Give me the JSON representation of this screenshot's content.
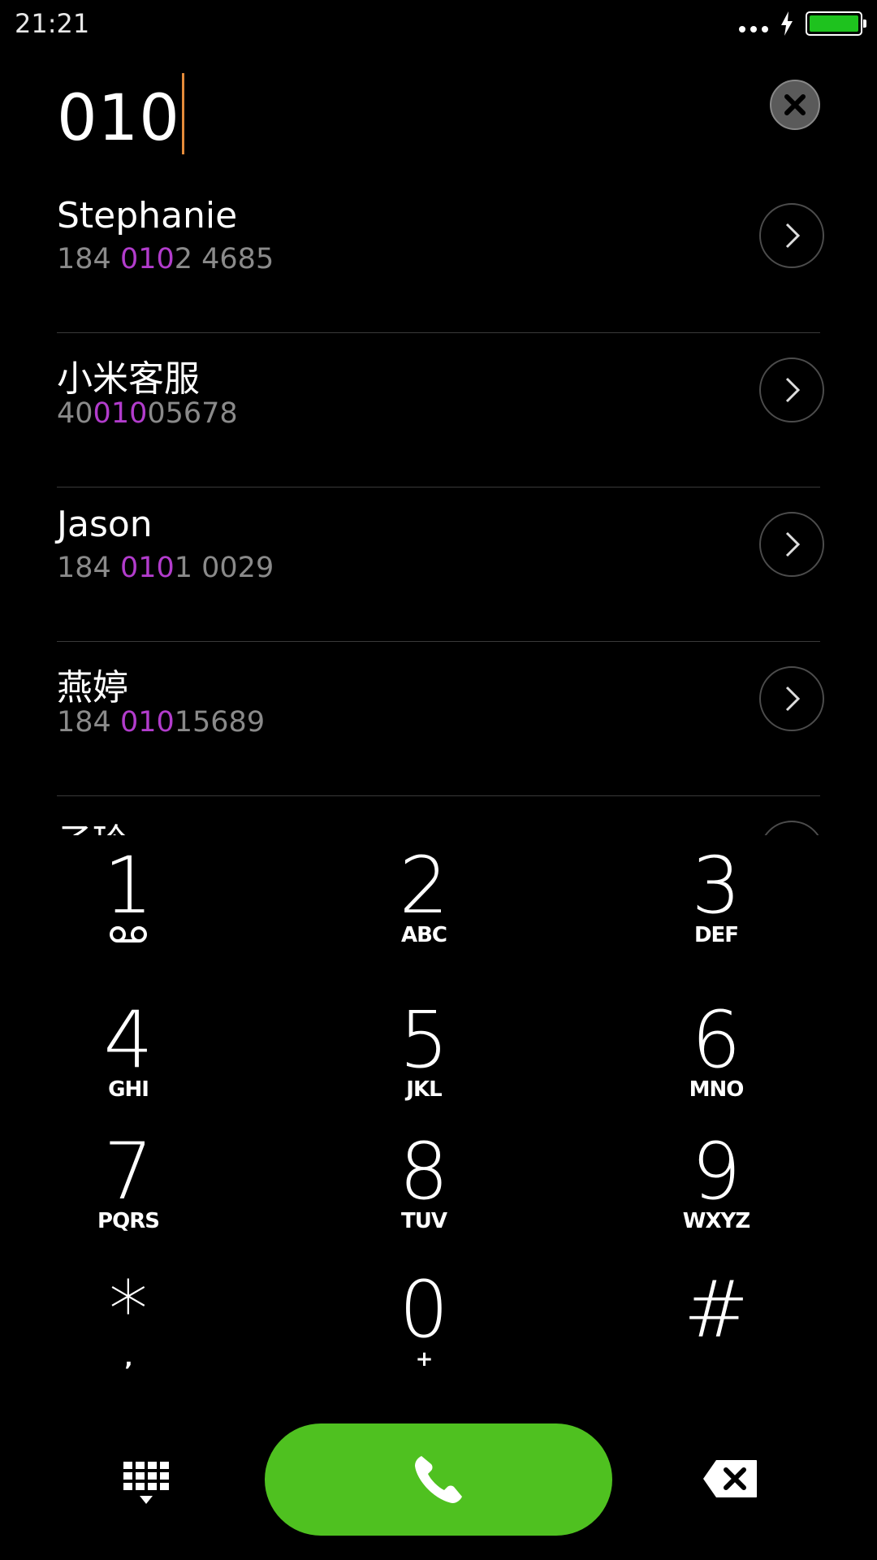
{
  "status_bar": {
    "time": "21:21",
    "battery_color": "#1ec21e",
    "icons": [
      "more-dots-icon",
      "charging-icon",
      "battery-icon"
    ]
  },
  "dialer": {
    "entered_number": "010"
  },
  "results": [
    {
      "name": "Stephanie",
      "number_pre": "184 ",
      "number_match": "010",
      "number_post": "2 4685"
    },
    {
      "name": "小米客服",
      "number_pre": "40",
      "number_match": "010",
      "number_post": "05678"
    },
    {
      "name": "Jason",
      "number_pre": "184 ",
      "number_match": "010",
      "number_post": "1 0029"
    },
    {
      "name": "燕婷",
      "number_pre": "184 ",
      "number_match": "010",
      "number_post": "15689"
    },
    {
      "name": "子玲",
      "number_pre": "",
      "number_match": "",
      "number_post": ""
    }
  ],
  "keypad": {
    "keys": [
      {
        "digit": "1",
        "letters": ""
      },
      {
        "digit": "2",
        "letters": "ABC"
      },
      {
        "digit": "3",
        "letters": "DEF"
      },
      {
        "digit": "4",
        "letters": "GHI"
      },
      {
        "digit": "5",
        "letters": "JKL"
      },
      {
        "digit": "6",
        "letters": "MNO"
      },
      {
        "digit": "7",
        "letters": "PQRS"
      },
      {
        "digit": "8",
        "letters": "TUV"
      },
      {
        "digit": "9",
        "letters": "WXYZ"
      },
      {
        "digit": "*",
        "letters": ","
      },
      {
        "digit": "0",
        "letters": "+"
      },
      {
        "digit": "#",
        "letters": ""
      }
    ]
  },
  "colors": {
    "match_highlight": "#b23ccc",
    "call_button": "#4fc120",
    "caret": "#e58b3a"
  }
}
